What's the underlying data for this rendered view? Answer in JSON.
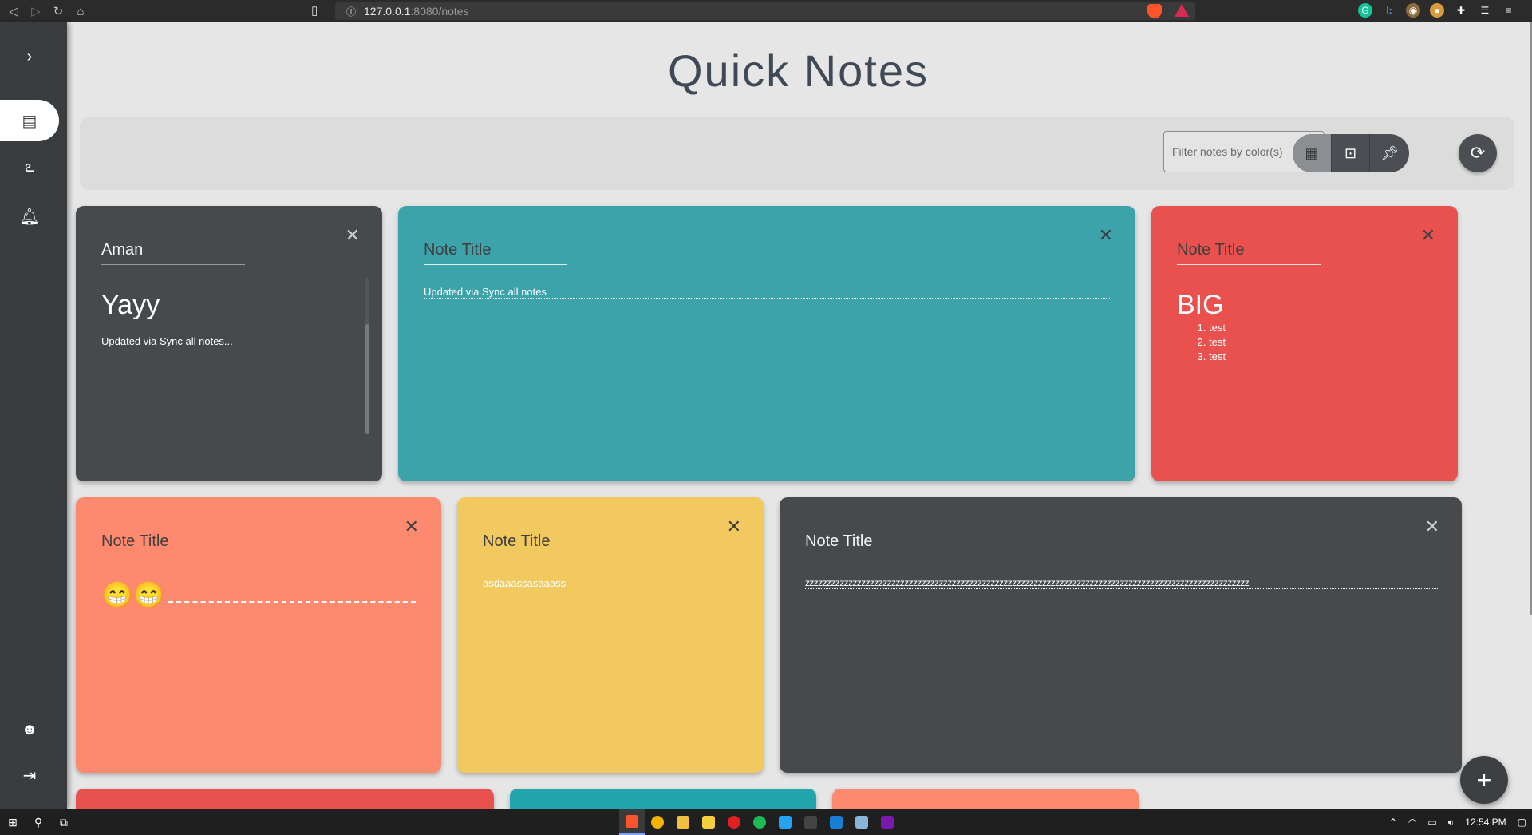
{
  "browser": {
    "url_host": "127.0.0.1",
    "url_path": ":8080/notes"
  },
  "app": {
    "title": "Quick Notes"
  },
  "toolbar": {
    "filter_placeholder": "Filter notes by color(s)"
  },
  "notes": [
    {
      "title": "Aman",
      "heading": "Yayy",
      "body": "Updated via Sync all notes...",
      "color": "#464a4c"
    },
    {
      "title": "Note Title",
      "body": "Updated via Sync all notes",
      "color": "#3ca3ab"
    },
    {
      "title": "Note Title",
      "heading": "BIG",
      "list": [
        "test",
        "test",
        "test"
      ],
      "color": "#e9514f"
    },
    {
      "title": "Note Title",
      "emoji": "😁😁",
      "color": "#fd8a6f"
    },
    {
      "title": "Note Title",
      "body": "asdaaassasaaass",
      "color": "#f2c95f"
    },
    {
      "title": "Note Title",
      "body": "zzzzzzzzzzzzzzzzzzzzzzzzzzzzzzzzzzzzzzzzzzzzzzzzzzzzzzzzzzzzzzzzzzzzzzzzzzzzzzzzzzzzzzzzzzzzzzzzzzzzzzz",
      "color": "#464a4c"
    }
  ],
  "partial_notes_colors": [
    "#e9514f",
    "#21a6b0",
    "#fd8a6f"
  ],
  "taskbar": {
    "time": "12:54 PM"
  },
  "colors": {
    "sidebar": "#3a3d3f",
    "background": "#e6e6e6",
    "title": "#3f4a56"
  }
}
